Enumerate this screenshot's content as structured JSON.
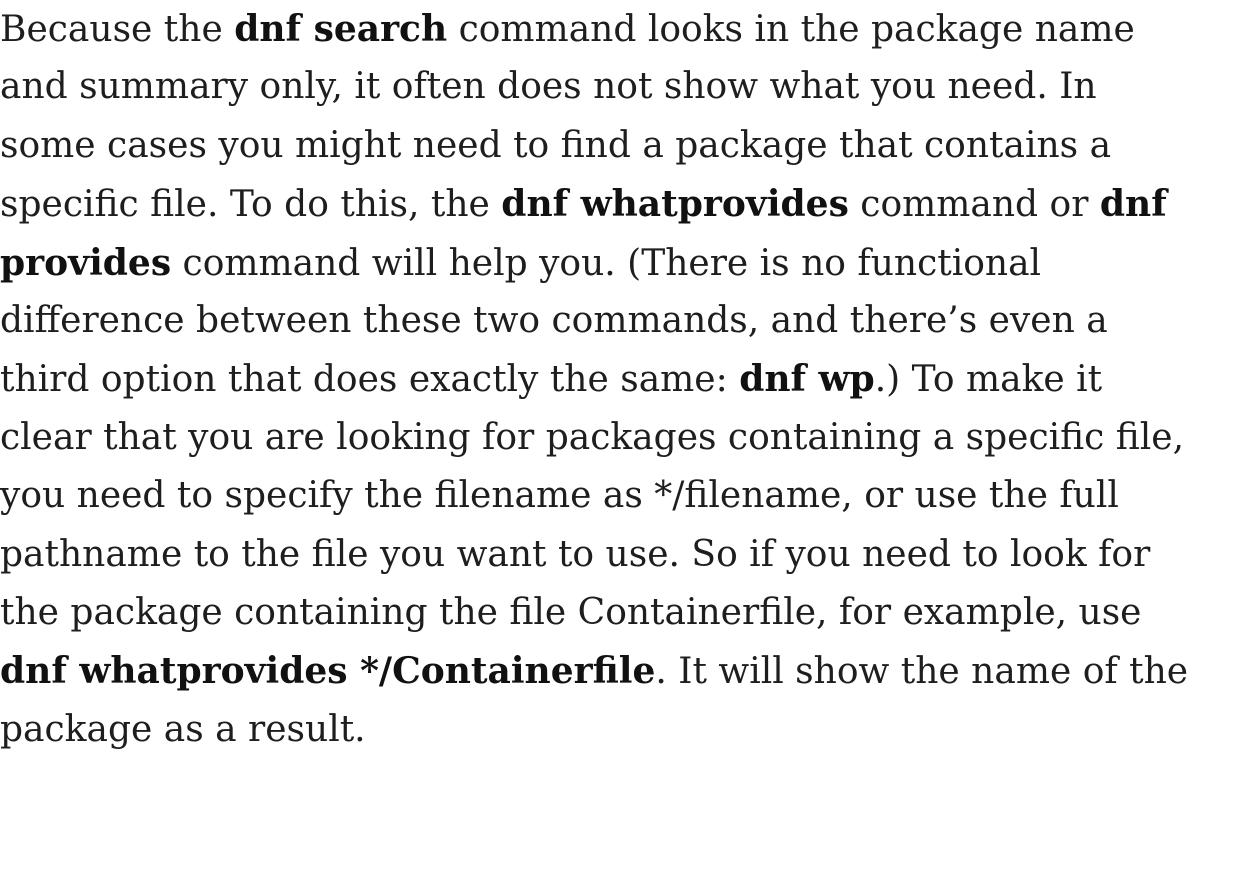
{
  "paragraph": {
    "lines": [
      [
        {
          "text": "Because the ",
          "bold": false
        },
        {
          "text": "dnf search",
          "bold": true
        },
        {
          "text": " command looks in the package name",
          "bold": false
        }
      ],
      [
        {
          "text": "and summary only, it often does not show what you need. In",
          "bold": false
        }
      ],
      [
        {
          "text": "some cases you might need to find a package that contains a",
          "bold": false
        }
      ],
      [
        {
          "text": "specific file. To do this, the ",
          "bold": false
        },
        {
          "text": "dnf whatprovides",
          "bold": true
        },
        {
          "text": " command or ",
          "bold": false
        },
        {
          "text": "dnf",
          "bold": true
        }
      ],
      [
        {
          "text": "provides",
          "bold": true
        },
        {
          "text": " command will help you. (There is no functional",
          "bold": false
        }
      ],
      [
        {
          "text": "difference between these two commands, and there’s even a",
          "bold": false
        }
      ],
      [
        {
          "text": "third option that does exactly the same: ",
          "bold": false
        },
        {
          "text": "dnf wp",
          "bold": true
        },
        {
          "text": ".) To make it",
          "bold": false
        }
      ],
      [
        {
          "text": "clear that you are looking for packages containing a specific file,",
          "bold": false
        }
      ],
      [
        {
          "text": "you need to specify the filename as */filename, or use the full",
          "bold": false
        }
      ],
      [
        {
          "text": "pathname to the file you want to use. So if you need to look for",
          "bold": false
        }
      ],
      [
        {
          "text": "the package containing the file Containerfile, for example, use",
          "bold": false
        }
      ],
      [
        {
          "text": "dnf whatprovides */Containerfile",
          "bold": true
        },
        {
          "text": ". It will show the name of the",
          "bold": false
        }
      ],
      [
        {
          "text": "package as a result.",
          "bold": false
        }
      ]
    ]
  }
}
